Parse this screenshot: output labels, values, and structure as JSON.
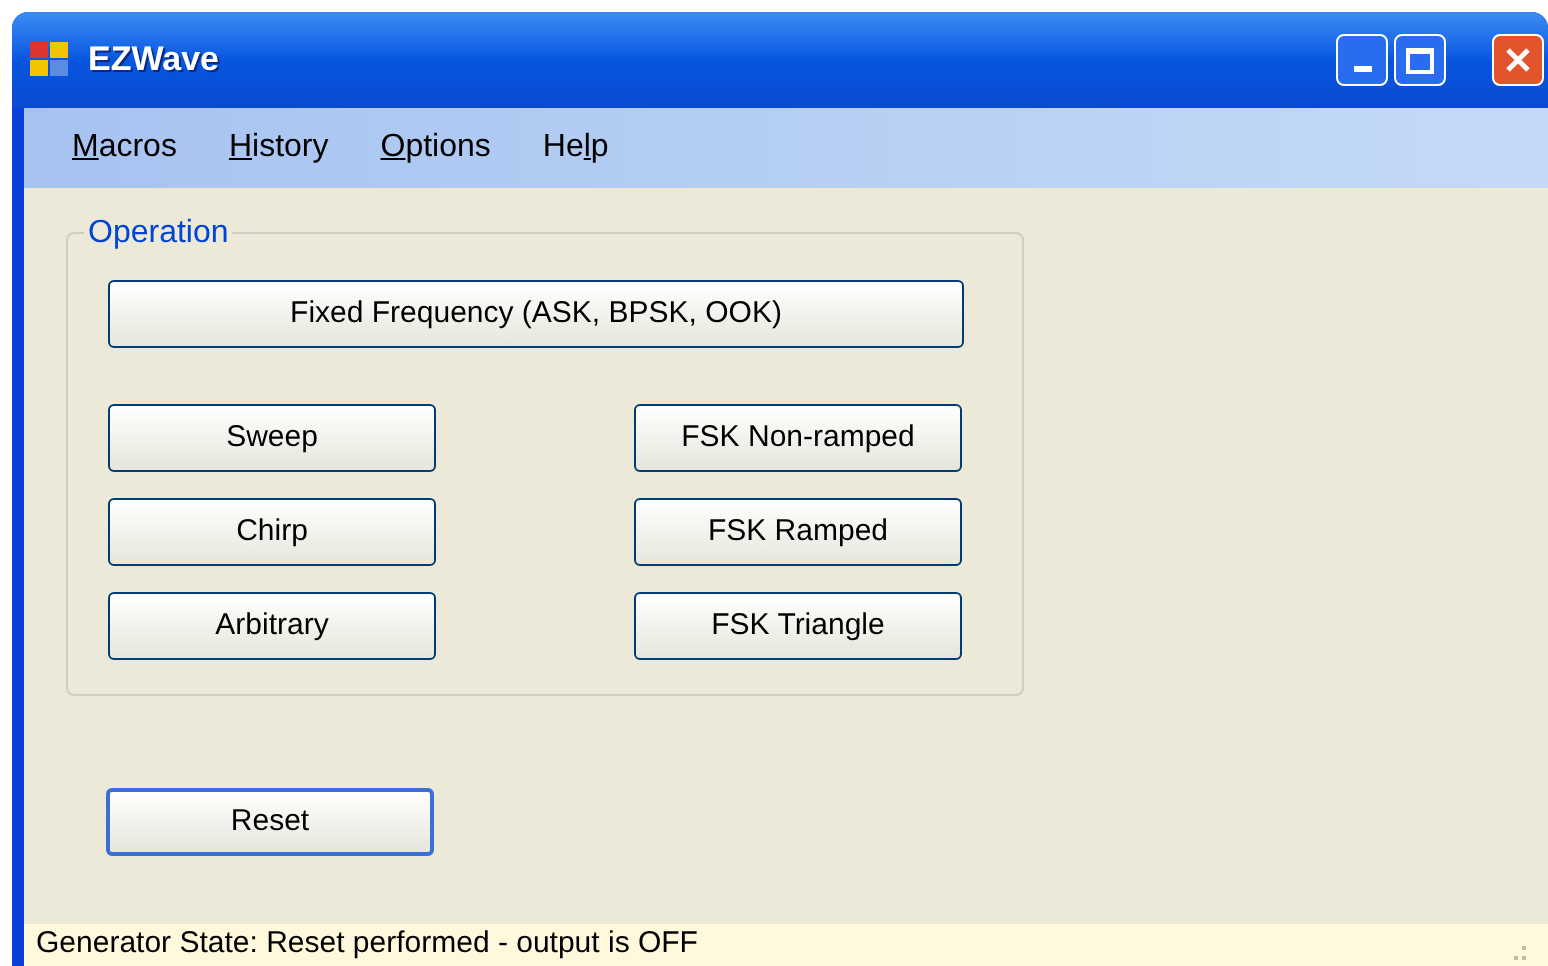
{
  "window": {
    "title": "EZWave"
  },
  "menu": [
    {
      "key": "M",
      "after": "acros"
    },
    {
      "key": "H",
      "after": "istory"
    },
    {
      "key": "O",
      "after": "ptions"
    },
    {
      "before": "He",
      "key": "l",
      "after": "p"
    }
  ],
  "operation": {
    "title": "Operation",
    "wide_button": {
      "label": "Fixed Frequency (ASK, BPSK, OOK)",
      "focused": false
    },
    "left_buttons": [
      {
        "label": "Sweep",
        "focused": false
      },
      {
        "label": "Chirp",
        "focused": false
      },
      {
        "label": "Arbitrary",
        "focused": false
      }
    ],
    "right_buttons": [
      {
        "label": "FSK Non-ramped",
        "focused": false
      },
      {
        "label": "FSK Ramped",
        "focused": false
      },
      {
        "label": "FSK Triangle",
        "focused": false
      }
    ]
  },
  "reset_button": {
    "label": "Reset",
    "focused": true
  },
  "status_bar": {
    "text": "Generator State: Reset performed - output is OFF"
  }
}
